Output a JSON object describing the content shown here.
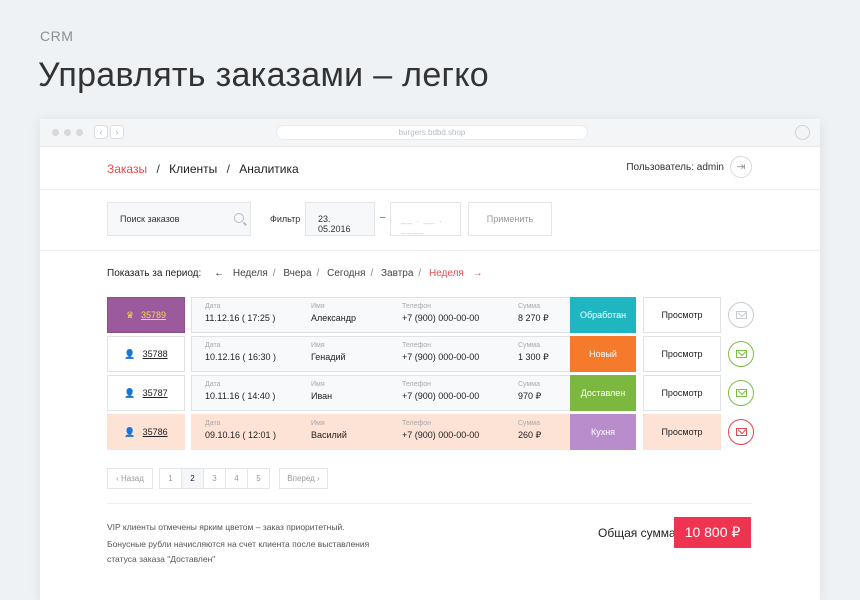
{
  "header": {
    "eyebrow": "CRM",
    "headline": "Управлять заказами – легко"
  },
  "browser": {
    "url": "burgers.bdbd.shop"
  },
  "nav": {
    "items": [
      {
        "label": "Заказы",
        "active": true
      },
      {
        "label": "Клиенты",
        "active": false
      },
      {
        "label": "Аналитика",
        "active": false
      }
    ],
    "separator": "/",
    "user_label": "Пользователь: admin"
  },
  "filters": {
    "search_placeholder": "Поиск заказов",
    "filter_label": "Фильтр",
    "date_from": "23. 05.2016",
    "date_sep": "–",
    "date_to_placeholder": "__ . __ . ____",
    "apply_label": "Применить"
  },
  "period": {
    "label": "Показать за период:",
    "prev_arrow": "←",
    "next_arrow": "→",
    "options": [
      "Неделя",
      "Вчера",
      "Сегодня",
      "Завтра",
      "Неделя"
    ],
    "active_index": 4
  },
  "orders": {
    "field_labels": {
      "date": "Дата",
      "name": "Имя",
      "phone": "Телефон",
      "sum": "Сумма"
    },
    "view_label": "Просмотр",
    "rows": [
      {
        "id": "35789",
        "vip": true,
        "date": "11.12.16  ( 17:25 )",
        "name": "Александр",
        "phone": "+7 (900) 000-00-00",
        "sum": "8 270 ₽",
        "status": "Обработан",
        "status_color": "#1fb6c1",
        "mail_color": "#c8cbce"
      },
      {
        "id": "35788",
        "vip": false,
        "date": "10.12.16  ( 16:30 )",
        "name": "Генадий",
        "phone": "+7 (900) 000-00-00",
        "sum": "1 300 ₽",
        "status": "Новый",
        "status_color": "#f57a2b",
        "mail_color": "#7cbf44"
      },
      {
        "id": "35787",
        "vip": false,
        "date": "10.11.16  ( 14:40 )",
        "name": "Иван",
        "phone": "+7 (900) 000-00-00",
        "sum": "970 ₽",
        "status": "Доставлен",
        "status_color": "#7cb840",
        "mail_color": "#7cbf44"
      },
      {
        "id": "35786",
        "vip": false,
        "highlight": true,
        "date": "09.10.16  ( 12:01 )",
        "name": "Василий",
        "phone": "+7 (900) 000-00-00",
        "sum": "260 ₽",
        "status": "Кухня",
        "status_color": "#b98ccb",
        "mail_color": "#e8484c"
      }
    ]
  },
  "pagination": {
    "prev": "Назад",
    "next": "Вперед",
    "pages": [
      "1",
      "2",
      "3",
      "4",
      "5"
    ],
    "current": "2"
  },
  "footer": {
    "note1": "VIP клиенты отмечены ярким цветом – заказ приоритетный.",
    "note2": "Бонусные рубли начисляются на счет клиента после выставления статуса заказа \"Доставлен\"",
    "total_label": "Общая сумма",
    "total_value": "10 800 ₽"
  },
  "colors": {
    "accent": "#e8484c",
    "vip": "#9b5a9b",
    "total_bg": "#ee3450"
  }
}
